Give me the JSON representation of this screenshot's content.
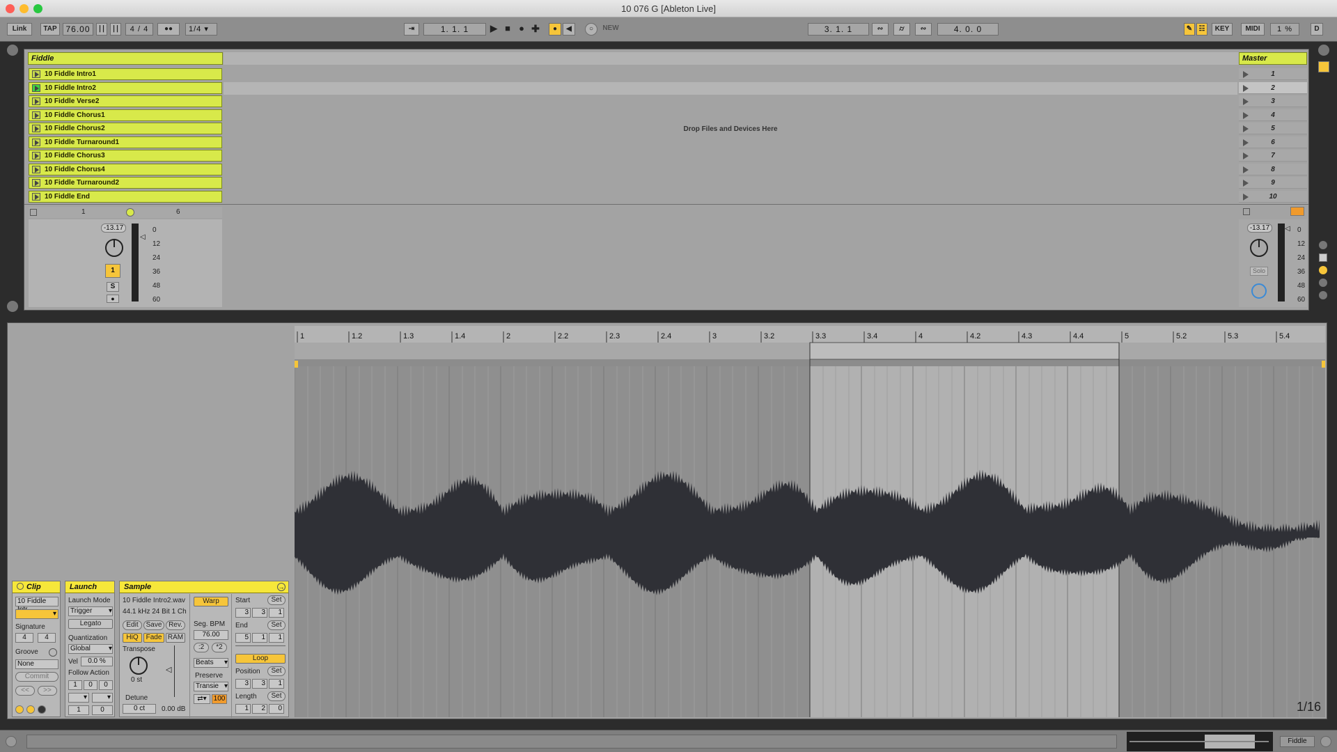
{
  "window": {
    "title": "10 076 G  [Ableton Live]"
  },
  "controlbar": {
    "link": "Link",
    "tap": "TAP",
    "tempo": "76.00",
    "meter": "4 / 4",
    "quant": "1/4",
    "position": "1.   1.   1",
    "new_label": "NEW",
    "loop_start": "3.   1.   1",
    "loop_length": "4.   0.   0",
    "key": "KEY",
    "midi": "MIDI",
    "cpu": "1 %",
    "d": "D"
  },
  "session": {
    "track_name": "Fiddle",
    "clips": [
      "10 Fiddle Intro1",
      "10 Fiddle Intro2",
      "10 Fiddle Verse2",
      "10 Fiddle Chorus1",
      "10 Fiddle Chorus2",
      "10 Fiddle Turnaround1",
      "10 Fiddle Chorus3",
      "10 Fiddle Chorus4",
      "10 Fiddle Turnaround2",
      "10 Fiddle End"
    ],
    "drop_text": "Drop Files and Devices Here",
    "master_name": "Master",
    "scenes": [
      "1",
      "2",
      "3",
      "4",
      "5",
      "6",
      "7",
      "8",
      "9",
      "10"
    ],
    "io_left": "1",
    "io_right": "6"
  },
  "mixer": {
    "track_volume": "-13.17",
    "master_volume": "-13.17",
    "scale": [
      "0",
      "12",
      "24",
      "36",
      "48",
      "60"
    ],
    "track_number": "1",
    "solo": "S",
    "master_solo": "Solo"
  },
  "clip_box": {
    "header": "Clip",
    "name": "10 Fiddle Intr",
    "signature_label": "Signature",
    "sig_num": "4",
    "sig_den": "4",
    "groove_label": "Groove",
    "groove_value": "None",
    "commit": "Commit"
  },
  "launch_box": {
    "header": "Launch",
    "mode_label": "Launch Mode",
    "mode": "Trigger",
    "legato": "Legato",
    "quant_label": "Quantization",
    "quant": "Global",
    "vel_label": "Vel",
    "vel": "0.0 %",
    "follow_label": "Follow Action",
    "fa": [
      "1",
      "0",
      "0"
    ],
    "fb": [
      "1",
      "0"
    ]
  },
  "sample_box": {
    "header": "Sample",
    "file": "10 Fiddle Intro2.wav",
    "info": "44.1 kHz 24 Bit 1 Ch",
    "edit": "Edit",
    "save": "Save",
    "rev": "Rev.",
    "hiq": "HiQ",
    "fade": "Fade",
    "ram": "RAM",
    "transpose_label": "Transpose",
    "transpose": "0 st",
    "detune_label": "Detune",
    "detune": "0 ct",
    "gain": "0.00 dB",
    "warp": "Warp",
    "segbpm_label": "Seg. BPM",
    "segbpm": "76.00",
    "half": ":2",
    "double": "*2",
    "mode": "Beats",
    "preserve_label": "Preserve",
    "preserve": "Transie",
    "pct": "100",
    "start_label": "Start",
    "start": [
      "3",
      "3",
      "1"
    ],
    "end_label": "End",
    "end": [
      "5",
      "1",
      "1"
    ],
    "set": "Set",
    "loop": "Loop",
    "position_label": "Position",
    "position": [
      "3",
      "3",
      "1"
    ],
    "length_label": "Length",
    "length": [
      "1",
      "2",
      "0"
    ]
  },
  "waveform": {
    "ruler": [
      "1",
      "1.2",
      "1.3",
      "1.4",
      "2",
      "2.2",
      "2.3",
      "2.4",
      "3",
      "3.2",
      "3.3",
      "3.4",
      "4",
      "4.2",
      "4.3",
      "4.4",
      "5",
      "5.2",
      "5.3",
      "5.4"
    ],
    "zoom": "1/16",
    "loop_start_fraction": 0.5,
    "loop_end_fraction": 0.8
  },
  "statusbar": {
    "track": "Fiddle"
  },
  "colors": {
    "clip": "#d8e94a",
    "header": "#f6e73a",
    "orange": "#f6c53a",
    "waveform": "#2f3036"
  }
}
